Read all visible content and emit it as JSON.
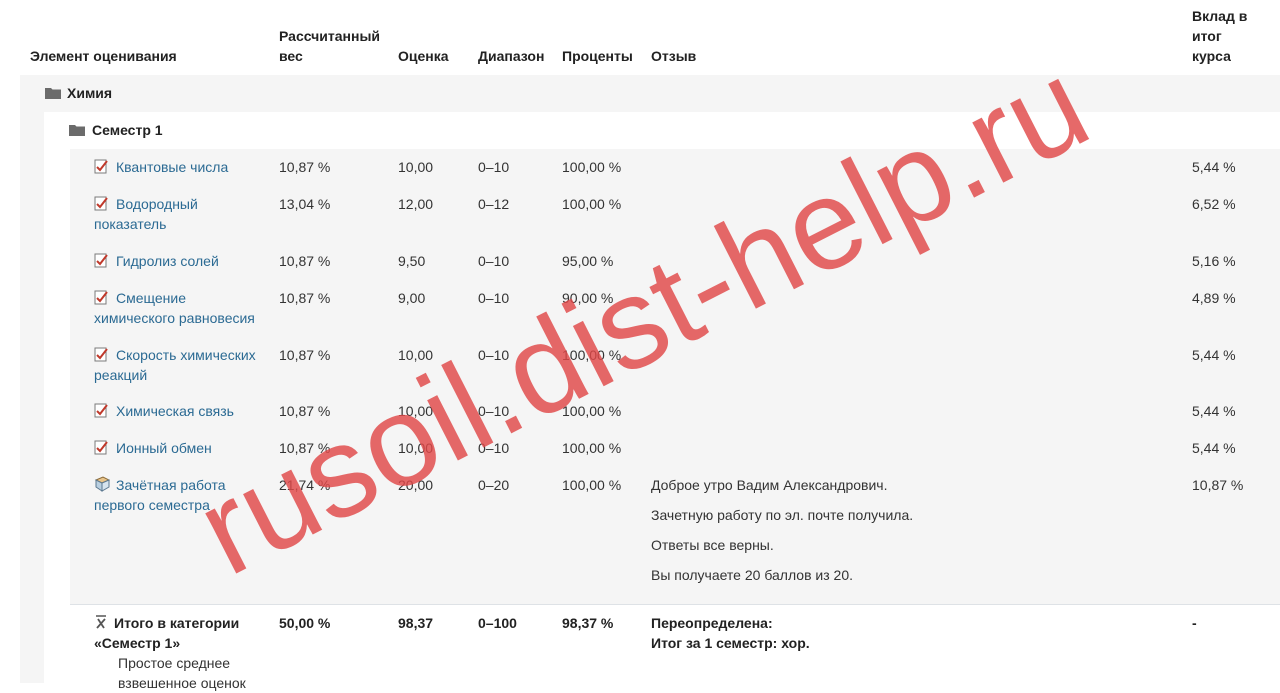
{
  "header": {
    "item": "Элемент оценивания",
    "weight_line1": "Рассчитанный",
    "weight_line2": "вес",
    "grade": "Оценка",
    "range": "Диапазон",
    "percent": "Проценты",
    "feedback": "Отзыв",
    "contrib_line1": "Вклад в",
    "contrib_line2": "итог",
    "contrib_line3": "курса"
  },
  "course_category": "Химия",
  "semester_category": "Семестр 1",
  "items": [
    {
      "name_line1": "Квантовые числа",
      "name_line2": "",
      "weight": "10,87 %",
      "grade": "10,00",
      "range": "0–10",
      "percent": "100,00 %",
      "contrib": "5,44 %"
    },
    {
      "name_line1": "Водородный",
      "name_line2": "показатель",
      "weight": "13,04 %",
      "grade": "12,00",
      "range": "0–12",
      "percent": "100,00 %",
      "contrib": "6,52 %"
    },
    {
      "name_line1": "Гидролиз солей",
      "name_line2": "",
      "weight": "10,87 %",
      "grade": "9,50",
      "range": "0–10",
      "percent": "95,00 %",
      "contrib": "5,16 %"
    },
    {
      "name_line1": "Смещение",
      "name_line2": "химического равновесия",
      "weight": "10,87 %",
      "grade": "9,00",
      "range": "0–10",
      "percent": "90,00 %",
      "contrib": "4,89 %"
    },
    {
      "name_line1": "Скорость химических",
      "name_line2": "реакций",
      "weight": "10,87 %",
      "grade": "10,00",
      "range": "0–10",
      "percent": "100,00 %",
      "contrib": "5,44 %"
    },
    {
      "name_line1": "Химическая связь",
      "name_line2": "",
      "weight": "10,87 %",
      "grade": "10,00",
      "range": "0–10",
      "percent": "100,00 %",
      "contrib": "5,44 %"
    },
    {
      "name_line1": "Ионный обмен",
      "name_line2": "",
      "weight": "10,87 %",
      "grade": "10,00",
      "range": "0–10",
      "percent": "100,00 %",
      "contrib": "5,44 %"
    }
  ],
  "assignment": {
    "name_line1": "Зачётная работа",
    "name_line2": "первого семестра",
    "weight": "21,74 %",
    "grade": "20,00",
    "range": "0–20",
    "percent": "100,00 %",
    "contrib": "10,87 %",
    "feedback": [
      "Доброе утро Вадим Александрович.",
      "Зачетную работу по эл. почте получила.",
      "Ответы все верны.",
      "Вы получаете 20 баллов из 20."
    ]
  },
  "total": {
    "name_line1": "Итого в категории",
    "name_line2": "«Семестр 1»",
    "method_line1": "Простое среднее",
    "method_line2": "взвешенное оценок",
    "weight": "50,00 %",
    "grade": "98,37",
    "range": "0–100",
    "percent": "98,37 %",
    "feedback_line1": "Переопределена:",
    "feedback_line2": "Итог за 1 семестр: хор.",
    "contrib": "-"
  },
  "watermark": "rusoil.dist-help.ru",
  "colors": {
    "link": "#2b6a93",
    "stripe": "#f5f5f5",
    "watermark": "#e04848"
  }
}
